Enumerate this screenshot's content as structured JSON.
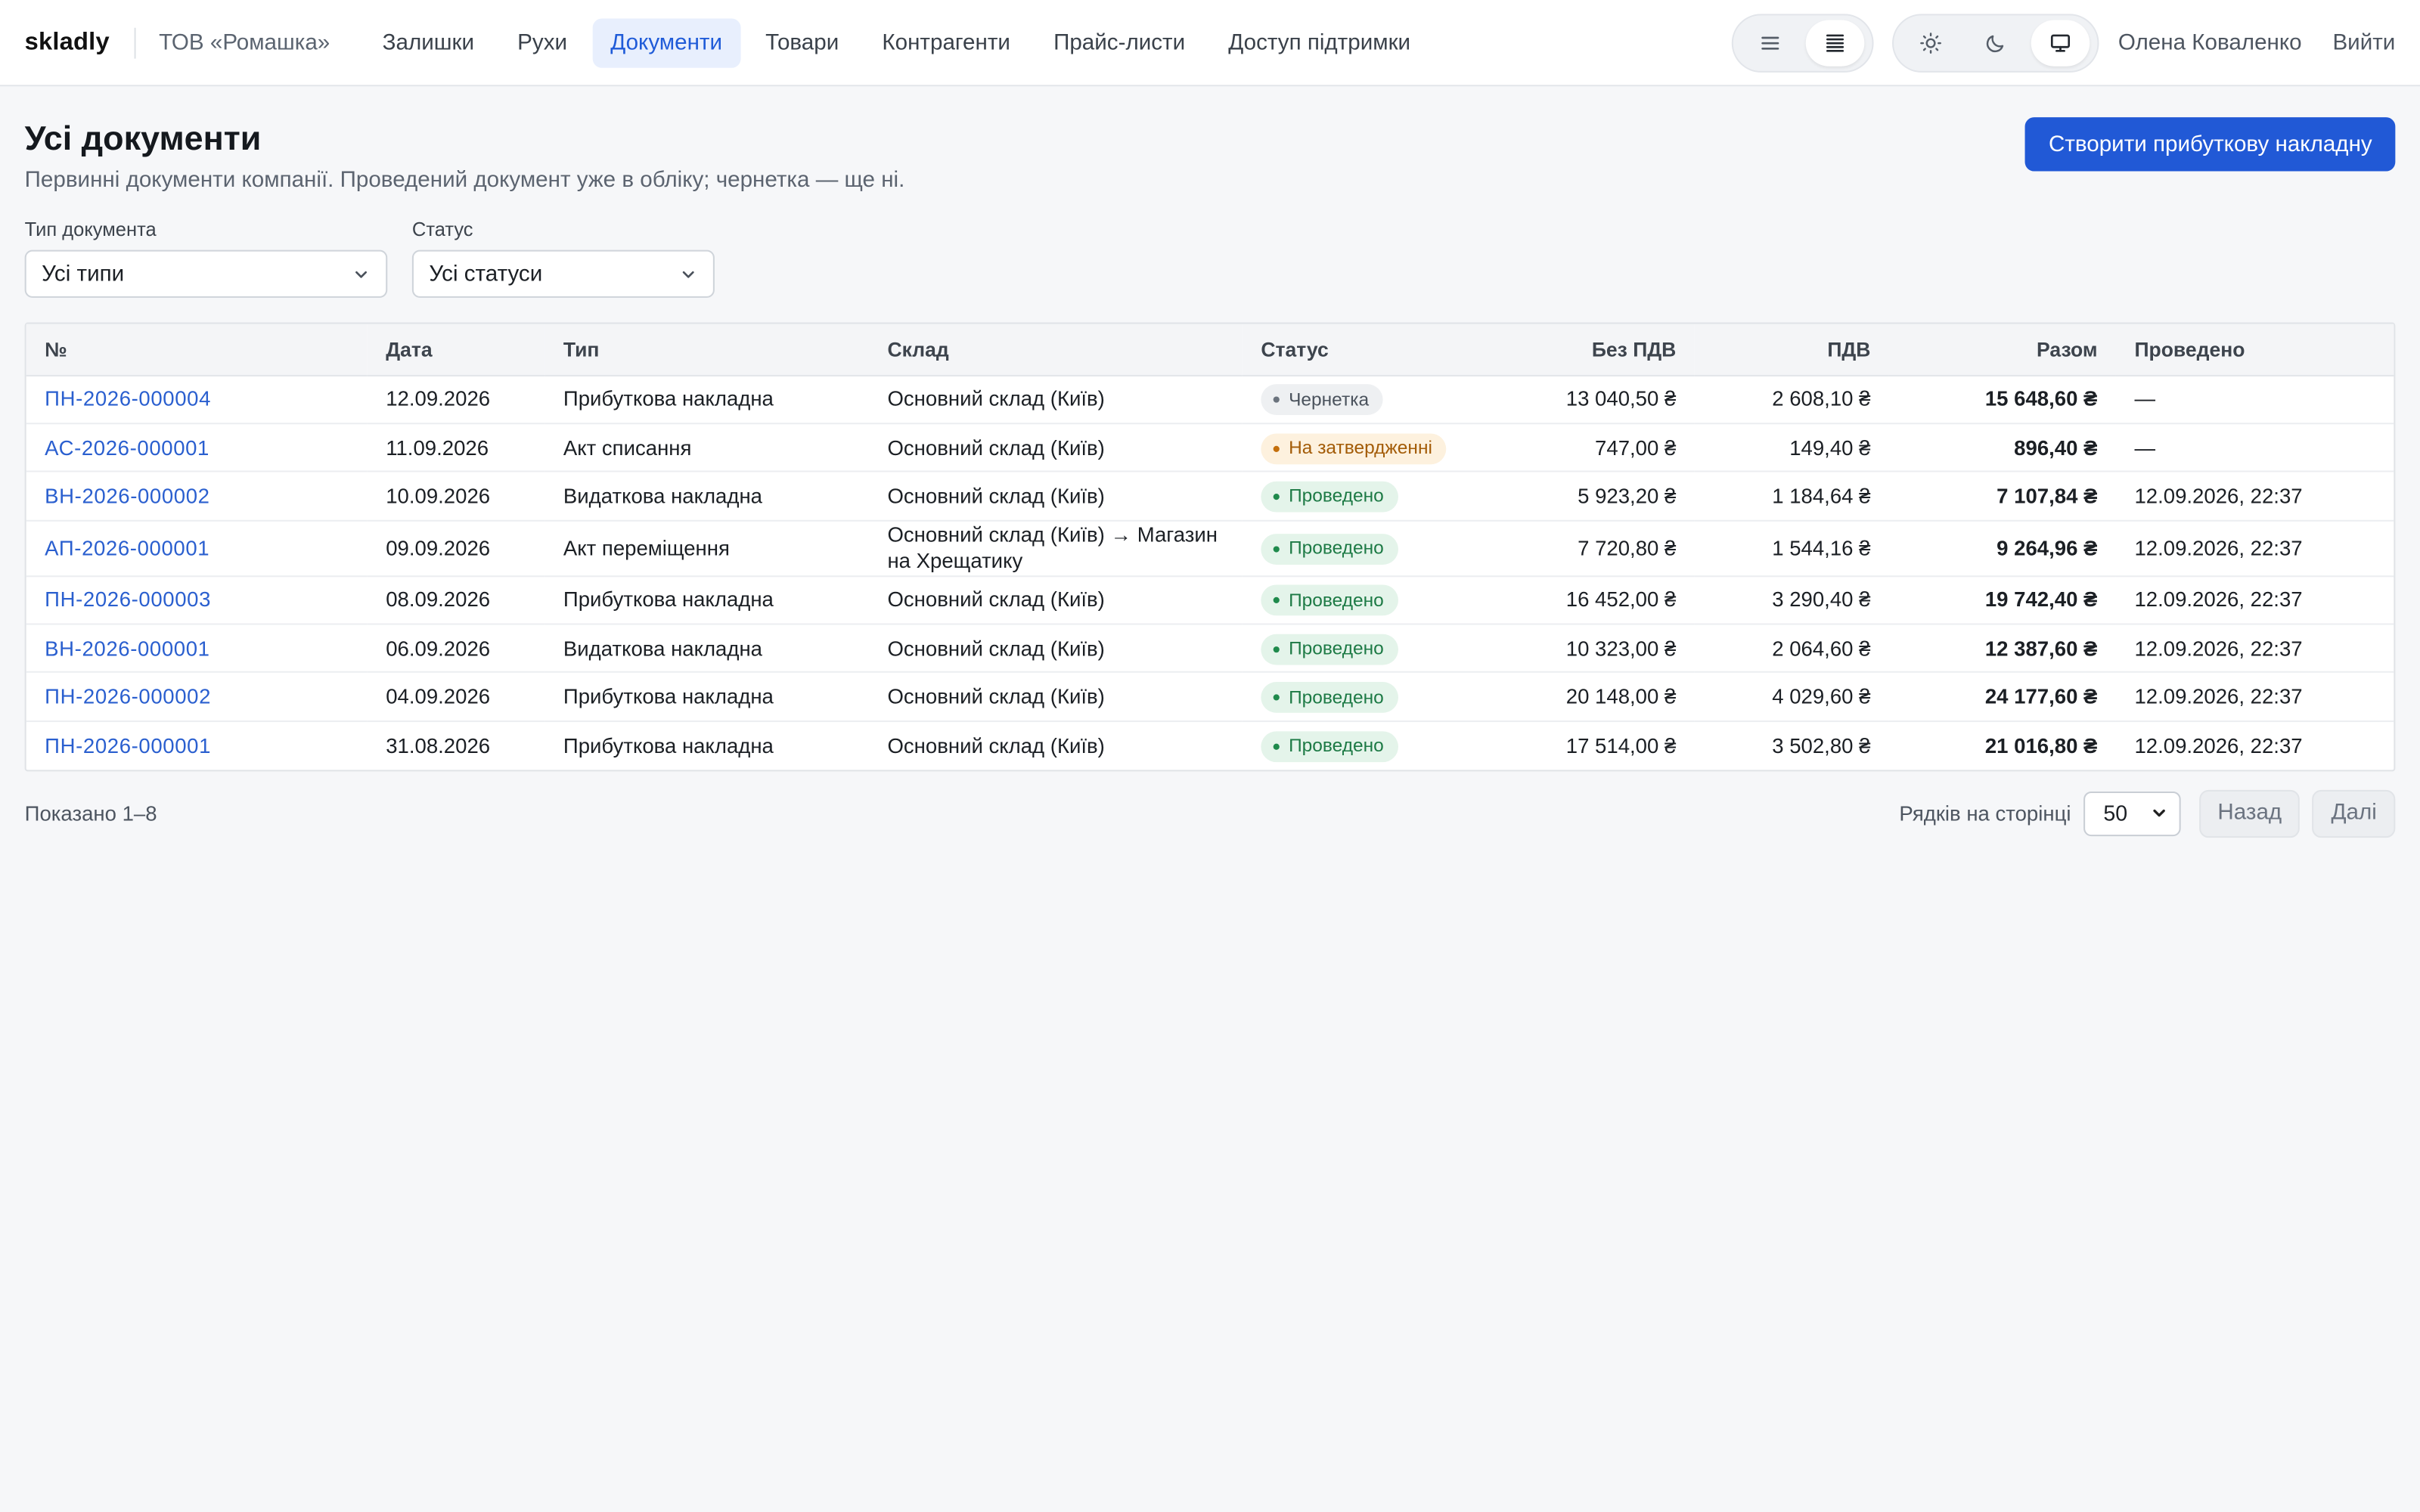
{
  "header": {
    "brand": "skladly",
    "company": "ТОВ «Ромашка»",
    "nav": [
      {
        "label": "Залишки",
        "active": false
      },
      {
        "label": "Рухи",
        "active": false
      },
      {
        "label": "Документи",
        "active": true
      },
      {
        "label": "Товари",
        "active": false
      },
      {
        "label": "Контрагенти",
        "active": false
      },
      {
        "label": "Прайс-листи",
        "active": false
      },
      {
        "label": "Доступ підтримки",
        "active": false
      }
    ],
    "density_toggle": [
      "list-icon",
      "dense-list-icon"
    ],
    "theme_toggle": [
      "sun-icon",
      "moon-icon",
      "monitor-icon"
    ],
    "user_name": "Олена Коваленко",
    "logout_label": "Вийти"
  },
  "page": {
    "title": "Усі документи",
    "subtitle": "Первинні документи компанії. Проведений документ уже в обліку; чернетка — ще ні.",
    "create_button": "Створити прибуткову накладну"
  },
  "filters": {
    "type_label": "Тип документа",
    "type_value": "Усі типи",
    "status_label": "Статус",
    "status_value": "Усі статуси"
  },
  "table": {
    "columns": {
      "number": "№",
      "date": "Дата",
      "type": "Тип",
      "warehouse": "Склад",
      "status": "Статус",
      "net": "Без ПДВ",
      "vat": "ПДВ",
      "total": "Разом",
      "posted": "Проведено"
    },
    "rows": [
      {
        "number": "ПН-2026-000004",
        "date": "12.09.2026",
        "type": "Прибуткова накладна",
        "warehouse": "Основний склад (Київ)",
        "status": "Чернетка",
        "status_kind": "draft",
        "net": "13 040,50 ₴",
        "vat": "2 608,10 ₴",
        "total": "15 648,60 ₴",
        "posted": "—"
      },
      {
        "number": "АС-2026-000001",
        "date": "11.09.2026",
        "type": "Акт списання",
        "warehouse": "Основний склад (Київ)",
        "status": "На затвердженні",
        "status_kind": "pending",
        "net": "747,00 ₴",
        "vat": "149,40 ₴",
        "total": "896,40 ₴",
        "posted": "—"
      },
      {
        "number": "ВН-2026-000002",
        "date": "10.09.2026",
        "type": "Видаткова накладна",
        "warehouse": "Основний склад (Київ)",
        "status": "Проведено",
        "status_kind": "posted",
        "net": "5 923,20 ₴",
        "vat": "1 184,64 ₴",
        "total": "7 107,84 ₴",
        "posted": "12.09.2026, 22:37"
      },
      {
        "number": "АП-2026-000001",
        "date": "09.09.2026",
        "type": "Акт переміщення",
        "warehouse": "Основний склад (Київ) → Магазин на Хрещатику",
        "status": "Проведено",
        "status_kind": "posted",
        "net": "7 720,80 ₴",
        "vat": "1 544,16 ₴",
        "total": "9 264,96 ₴",
        "posted": "12.09.2026, 22:37"
      },
      {
        "number": "ПН-2026-000003",
        "date": "08.09.2026",
        "type": "Прибуткова накладна",
        "warehouse": "Основний склад (Київ)",
        "status": "Проведено",
        "status_kind": "posted",
        "net": "16 452,00 ₴",
        "vat": "3 290,40 ₴",
        "total": "19 742,40 ₴",
        "posted": "12.09.2026, 22:37"
      },
      {
        "number": "ВН-2026-000001",
        "date": "06.09.2026",
        "type": "Видаткова накладна",
        "warehouse": "Основний склад (Київ)",
        "status": "Проведено",
        "status_kind": "posted",
        "net": "10 323,00 ₴",
        "vat": "2 064,60 ₴",
        "total": "12 387,60 ₴",
        "posted": "12.09.2026, 22:37"
      },
      {
        "number": "ПН-2026-000002",
        "date": "04.09.2026",
        "type": "Прибуткова накладна",
        "warehouse": "Основний склад (Київ)",
        "status": "Проведено",
        "status_kind": "posted",
        "net": "20 148,00 ₴",
        "vat": "4 029,60 ₴",
        "total": "24 177,60 ₴",
        "posted": "12.09.2026, 22:37"
      },
      {
        "number": "ПН-2026-000001",
        "date": "31.08.2026",
        "type": "Прибуткова накладна",
        "warehouse": "Основний склад (Київ)",
        "status": "Проведено",
        "status_kind": "posted",
        "net": "17 514,00 ₴",
        "vat": "3 502,80 ₴",
        "total": "21 016,80 ₴",
        "posted": "12.09.2026, 22:37"
      }
    ]
  },
  "footer": {
    "shown": "Показано 1–8",
    "rows_per_page_label": "Рядків на сторінці",
    "rows_per_page_value": "50",
    "prev_label": "Назад",
    "next_label": "Далі"
  },
  "colors": {
    "accent": "#2159d6",
    "link": "#2a5fcf",
    "posted": "#1d7a45",
    "pending": "#a35c08",
    "draft": "#4a525c"
  }
}
